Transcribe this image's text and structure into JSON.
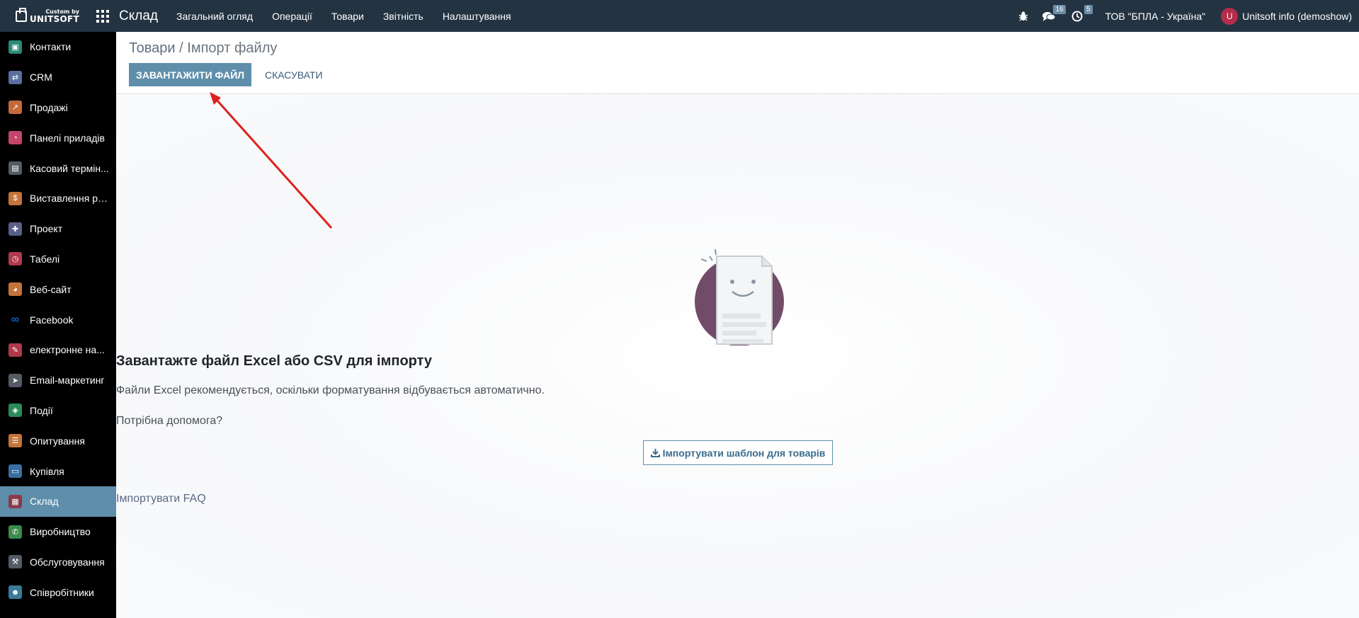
{
  "navbar": {
    "logo_small": "Custom by",
    "logo_big": "UNITSOFT",
    "app_title": "Склад",
    "menu": [
      "Загальний огляд",
      "Операції",
      "Товари",
      "Звітність",
      "Налаштування"
    ],
    "messages_count": "16",
    "activities_count": "5",
    "company": "ТОВ \"БПЛА - Україна\"",
    "avatar_letter": "U",
    "user": "Unitsoft info (demoshow)"
  },
  "sidebar": {
    "items": [
      {
        "label": "Контакти",
        "icon": "contacts-icon",
        "color": "#2a8a7a"
      },
      {
        "label": "CRM",
        "icon": "handshake-icon",
        "color": "#5a6ea0"
      },
      {
        "label": "Продажі",
        "icon": "chart-icon",
        "color": "#c46a3a"
      },
      {
        "label": "Панелі приладів",
        "icon": "dashboard-icon",
        "color": "#c4456a"
      },
      {
        "label": "Касовий термін...",
        "icon": "store-icon",
        "color": "#555b66"
      },
      {
        "label": "Виставлення ра...",
        "icon": "invoice-icon",
        "color": "#c4733a"
      },
      {
        "label": "Проект",
        "icon": "puzzle-icon",
        "color": "#5a5f8a"
      },
      {
        "label": "Табелі",
        "icon": "stopwatch-icon",
        "color": "#b0394a"
      },
      {
        "label": "Веб-сайт",
        "icon": "globe-icon",
        "color": "#c4733a"
      },
      {
        "label": "Facebook",
        "icon": "meta-icon",
        "color": "#000000"
      },
      {
        "label": "електронне на...",
        "icon": "elearning-icon",
        "color": "#b0394a"
      },
      {
        "label": "Email-маркетинг",
        "icon": "paper-plane-icon",
        "color": "#555b66"
      },
      {
        "label": "Події",
        "icon": "ticket-icon",
        "color": "#2a8a5a"
      },
      {
        "label": "Опитування",
        "icon": "survey-icon",
        "color": "#c4733a"
      },
      {
        "label": "Купівля",
        "icon": "credit-card-icon",
        "color": "#3a6ea0"
      },
      {
        "label": "Склад",
        "icon": "box-icon",
        "color": "#8a3a4a",
        "active": true
      },
      {
        "label": "Виробництво",
        "icon": "wrench-icon",
        "color": "#3a8a4a"
      },
      {
        "label": "Обслуговування",
        "icon": "hammer-icon",
        "color": "#555b66"
      },
      {
        "label": "Співробітники",
        "icon": "users-icon",
        "color": "#3a7a9a"
      }
    ]
  },
  "control": {
    "breadcrumb_parent": "Товари",
    "breadcrumb_sep": "/",
    "breadcrumb_current": "Імпорт файлу",
    "upload_label": "ЗАВАНТАЖИТИ ФАЙЛ",
    "cancel_label": "СКАСУВАТИ"
  },
  "main": {
    "title": "Завантажте файл Excel або CSV для імпорту",
    "subtitle": "Файли Excel рекомендується, оскільки форматування відбувається автоматично.",
    "help": "Потрібна допомога?",
    "template_button": "Імпортувати шаблон для товарів",
    "faq": "Імпортувати FAQ"
  }
}
